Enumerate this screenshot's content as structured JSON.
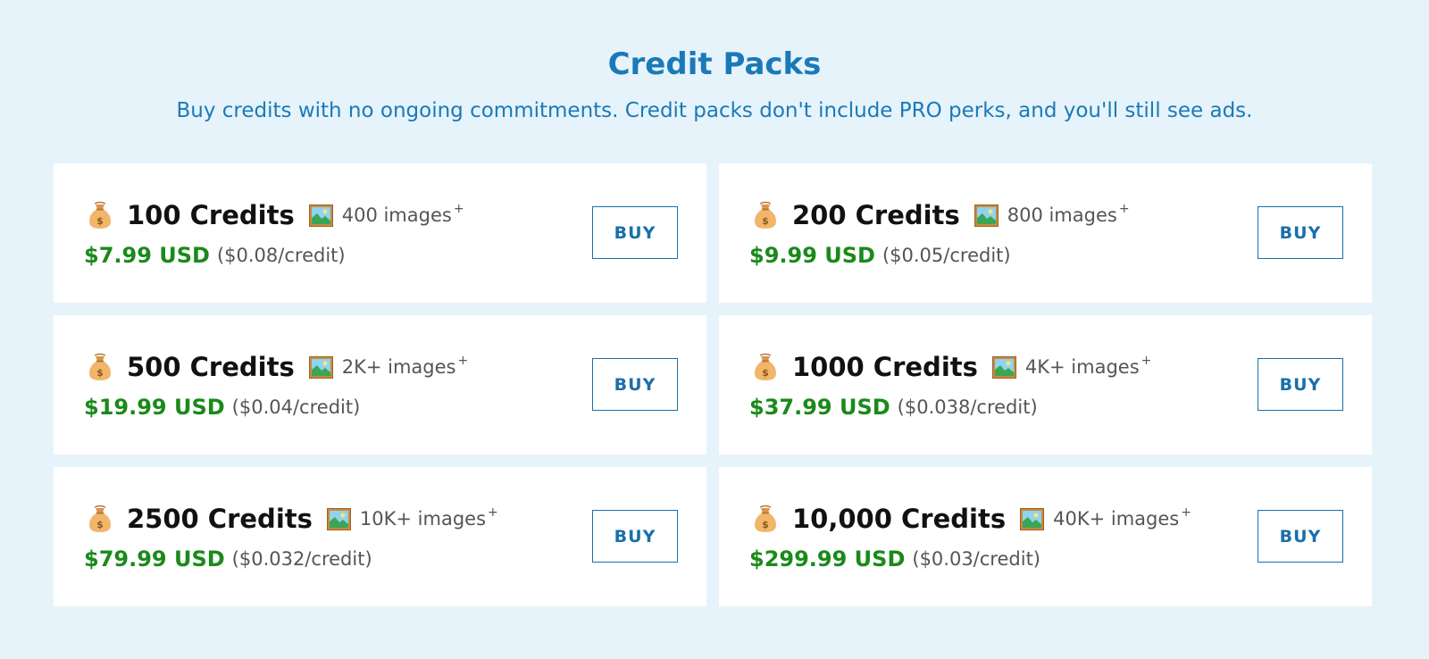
{
  "header": {
    "title": "Credit Packs",
    "subtitle": "Buy credits with no ongoing commitments. Credit packs don't include PRO perks, and you'll still see ads."
  },
  "icons": {
    "bag": "money-bag-icon",
    "picture": "framed-picture-icon"
  },
  "colors": {
    "accent": "#1a7ab8",
    "price": "#1a8a1a",
    "background": "#e6f3fa"
  },
  "packs": [
    {
      "credits": "100 Credits",
      "images": "400 images",
      "sup": "+",
      "price": "$7.99 USD",
      "per_credit": "($0.08/credit)",
      "buy_label": "BUY"
    },
    {
      "credits": "200 Credits",
      "images": "800 images",
      "sup": "+",
      "price": "$9.99 USD",
      "per_credit": "($0.05/credit)",
      "buy_label": "BUY"
    },
    {
      "credits": "500 Credits",
      "images": "2K+ images",
      "sup": "+",
      "price": "$19.99 USD",
      "per_credit": "($0.04/credit)",
      "buy_label": "BUY"
    },
    {
      "credits": "1000 Credits",
      "images": "4K+ images",
      "sup": "+",
      "price": "$37.99 USD",
      "per_credit": "($0.038/credit)",
      "buy_label": "BUY"
    },
    {
      "credits": "2500 Credits",
      "images": "10K+ images",
      "sup": "+",
      "price": "$79.99 USD",
      "per_credit": "($0.032/credit)",
      "buy_label": "BUY"
    },
    {
      "credits": "10,000 Credits",
      "images": "40K+ images",
      "sup": "+",
      "price": "$299.99 USD",
      "per_credit": "($0.03/credit)",
      "buy_label": "BUY"
    }
  ]
}
